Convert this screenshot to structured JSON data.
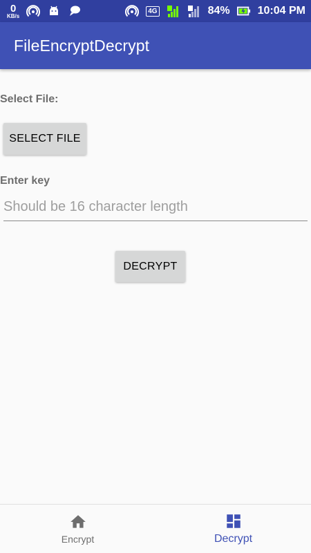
{
  "status_bar": {
    "speed_value": "0",
    "speed_unit": "KB/s",
    "network_type": "4G",
    "sim1": "1",
    "sim2": "2",
    "battery": "84%",
    "time": "10:04 PM",
    "icons": [
      "hotspot-icon",
      "android-icon",
      "chat-icon",
      "hotspot-icon",
      "signal-icon",
      "battery-charging-icon"
    ]
  },
  "toolbar": {
    "title": "FileEncryptDecrypt"
  },
  "form": {
    "select_file_label": "Select File:",
    "select_file_button": "SELECT FILE",
    "key_label": "Enter key",
    "key_value": "",
    "key_placeholder": "Should be 16 character length",
    "decrypt_button": "DECRYPT"
  },
  "bottom_nav": {
    "items": [
      {
        "label": "Encrypt",
        "icon": "home-icon",
        "active": false
      },
      {
        "label": "Decrypt",
        "icon": "dashboard-icon",
        "active": true
      }
    ]
  },
  "colors": {
    "status_bar": "#303f9f",
    "toolbar": "#3f51b5",
    "accent": "#3f51b5",
    "button": "#d6d7d7",
    "background": "#fafafa"
  }
}
